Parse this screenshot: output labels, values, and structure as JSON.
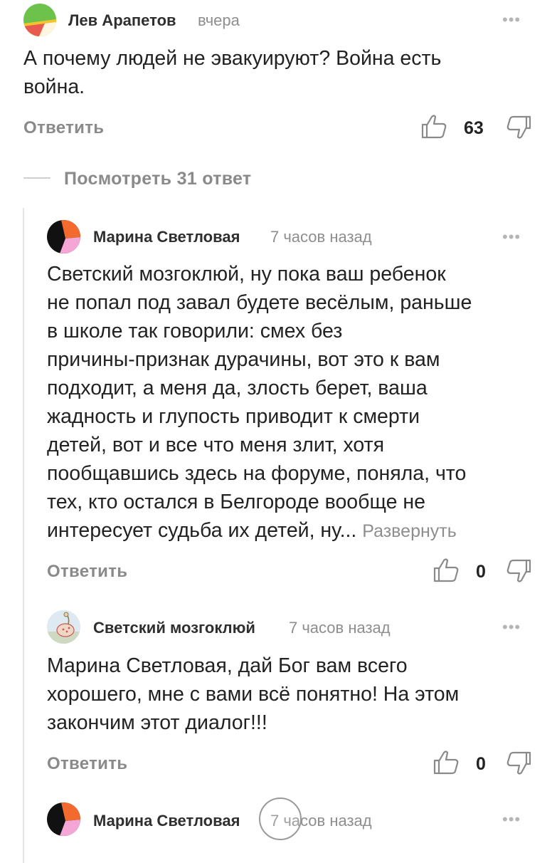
{
  "comment1": {
    "author": "Лев Арапетов",
    "time": "вчера",
    "text_lines": [
      "А почему людей не эвакуируют? Война есть",
      "война."
    ],
    "reply_label": "Ответить",
    "likes": "63",
    "avatar_colors": [
      "#6cc24a",
      "#f4c430",
      "#e85a4f"
    ]
  },
  "view_replies": "Посмотреть 31 ответ",
  "comment2": {
    "author": "Марина Светловая",
    "time": "7 часов назад",
    "text_lines": [
      "Светский мозгоклюй, ну пока ваш ребенок",
      "не попал под завал будете весёлым, раньше",
      "в школе так говорили: смех без",
      "причины-признак дурачины, вот это к вам",
      "подходит, а меня да, злость берет, ваша",
      "жадность и глупость приводит к смерти",
      "детей, вот и все что меня злит, хотя",
      "пообщавшись здесь на форуме, поняла, что",
      "тех, кто остался в Белгороде вообще не"
    ],
    "last_line": "интересует судьба их детей, ну...",
    "expand_label": "Развернуть",
    "reply_label": "Ответить",
    "likes": "0"
  },
  "comment3": {
    "author": "Светский мозгоклюй",
    "time": "7 часов назад",
    "text_lines": [
      "Марина Светловая, дай Бог вам всего",
      "хорошего, мне с вами всё понятно! На этом",
      "закончим этот диалог!!!"
    ],
    "reply_label": "Ответить",
    "likes": "0"
  },
  "comment4": {
    "author": "Марина Светловая",
    "time": "7 часов назад"
  },
  "more_icon": "•••",
  "colors": {
    "avatar_black": "#111111",
    "avatar_orange": "#f26a2e",
    "avatar_pink": "#f4a6d7"
  }
}
